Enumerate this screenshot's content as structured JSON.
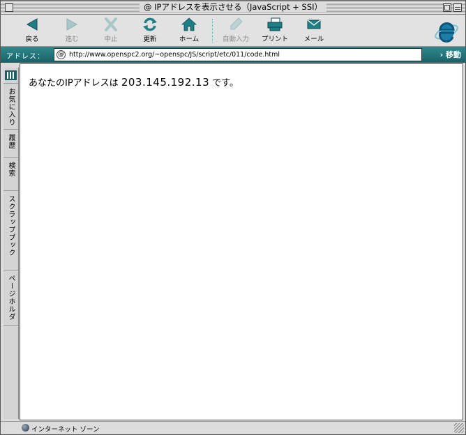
{
  "window": {
    "title": "IPアドレスを表示させる（JavaScript + SSI）"
  },
  "toolbar": {
    "buttons": [
      {
        "label": "戻る",
        "icon": "back-arrow-icon",
        "enabled": true
      },
      {
        "label": "進む",
        "icon": "forward-arrow-icon",
        "enabled": false
      },
      {
        "label": "中止",
        "icon": "stop-x-icon",
        "enabled": false
      },
      {
        "label": "更新",
        "icon": "refresh-icon",
        "enabled": true
      },
      {
        "label": "ホーム",
        "icon": "home-icon",
        "enabled": true
      },
      {
        "label": "自動入力",
        "icon": "autofill-pen-icon",
        "enabled": false
      },
      {
        "label": "プリント",
        "icon": "printer-icon",
        "enabled": true
      },
      {
        "label": "メール",
        "icon": "mail-envelope-icon",
        "enabled": true
      }
    ]
  },
  "address_bar": {
    "label": "アドレス：",
    "url": "http://www.openspc2.org/~openspc/JS/script/etc/011/code.html",
    "go_label": "移動"
  },
  "sidebar": {
    "tabs": [
      {
        "label": "お気に入り"
      },
      {
        "label": "履歴"
      },
      {
        "label": "検索"
      },
      {
        "label": "スクラップブック"
      },
      {
        "label": "ページホルダ"
      }
    ]
  },
  "content": {
    "prefix": "あなたのIPアドレスは",
    "ip": "203.145.192.13",
    "suffix": "です。"
  },
  "status": {
    "zone_text": "インターネット ゾーン"
  },
  "colors": {
    "accent_teal": "#1a6066",
    "icon_teal": "#1f7f86"
  }
}
